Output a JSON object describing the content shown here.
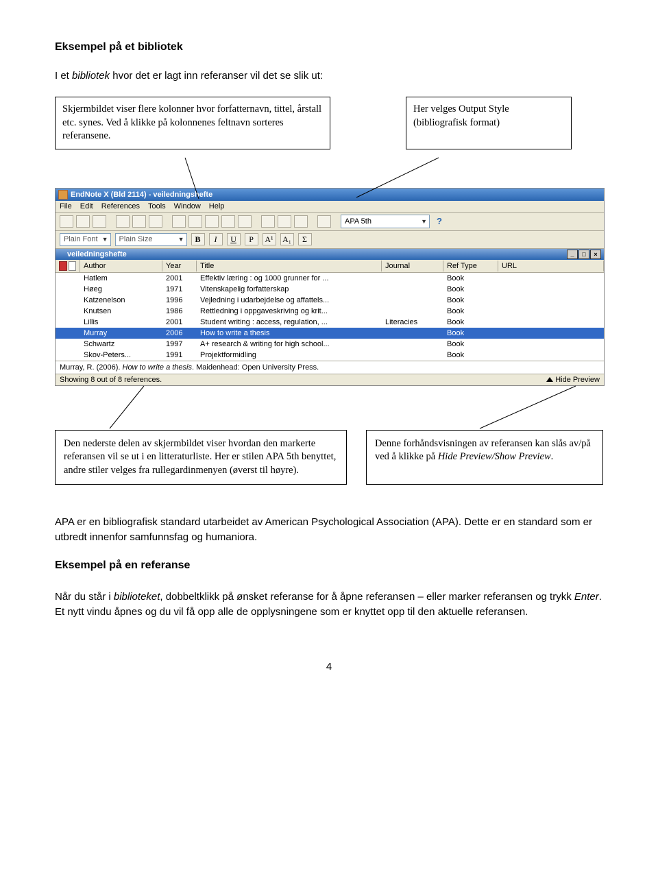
{
  "heading": "Eksempel på et bibliotek",
  "intro_1": "I et ",
  "intro_em": "bibliotek",
  "intro_2": " hvor det er lagt inn referanser vil det se slik ut:",
  "callout_left_top": "Skjermbildet viser flere kolonner hvor forfatternavn, tittel, årstall etc. synes. Ved å klikke på kolonnenes feltnavn sorteres referansene.",
  "callout_right_top": "Her velges Output Style (bibliografisk format)",
  "app": {
    "titlebar": "EndNote X (Bld 2114) - veiledningshefte",
    "menus": [
      "File",
      "Edit",
      "References",
      "Tools",
      "Window",
      "Help"
    ],
    "style_selected": "APA 5th",
    "plain_font": "Plain Font",
    "plain_size": "Plain Size",
    "fmt_buttons": [
      "B",
      "I",
      "U",
      "P",
      "A¹",
      "A₁",
      "Σ"
    ],
    "subwindow_title": "veiledningshefte",
    "columns": [
      "Author",
      "Year",
      "Title",
      "Journal",
      "Ref Type",
      "URL"
    ],
    "rows": [
      {
        "author": "Hatlem",
        "year": "2001",
        "title": "Effektiv læring : og 1000 grunner for ...",
        "journal": "",
        "ref": "Book",
        "url": ""
      },
      {
        "author": "Høeg",
        "year": "1971",
        "title": "Vitenskapelig forfatterskap",
        "journal": "",
        "ref": "Book",
        "url": ""
      },
      {
        "author": "Katzenelson",
        "year": "1996",
        "title": "Vejledning i udarbejdelse og affattels...",
        "journal": "",
        "ref": "Book",
        "url": ""
      },
      {
        "author": "Knutsen",
        "year": "1986",
        "title": "Rettledning i oppgaveskriving og krit...",
        "journal": "",
        "ref": "Book",
        "url": ""
      },
      {
        "author": "Lillis",
        "year": "2001",
        "title": "Student writing : access, regulation, ...",
        "journal": "Literacies",
        "ref": "Book",
        "url": ""
      },
      {
        "author": "Murray",
        "year": "2006",
        "title": "How to write a thesis",
        "journal": "",
        "ref": "Book",
        "url": "",
        "selected": true
      },
      {
        "author": "Schwartz",
        "year": "1997",
        "title": "A+ research & writing for high school...",
        "journal": "",
        "ref": "Book",
        "url": ""
      },
      {
        "author": "Skov-Peters...",
        "year": "1991",
        "title": "Projektformidling",
        "journal": "",
        "ref": "Book",
        "url": ""
      }
    ],
    "preview_author_year": "Murray, R. (2006). ",
    "preview_title_italic": "How to write a thesis",
    "preview_rest": ". Maidenhead: Open University Press.",
    "status_left": "Showing 8 out of 8 references.",
    "status_right": "Hide Preview"
  },
  "callout_left_bottom": "Den nederste delen av skjermbildet viser hvordan den markerte referansen vil se ut i en litteraturliste. Her er stilen APA 5th benyttet, andre stiler velges fra rullegardinmenyen (øverst til høyre).",
  "callout_right_bottom_1": "Denne forhåndsvisningen av referansen kan slås av/på ved å klikke på ",
  "callout_right_bottom_em": "Hide Preview/Show Preview",
  "callout_right_bottom_2": ".",
  "body_p1": "APA er en bibliografisk standard utarbeidet av American Psychological Association (APA). Dette er en standard som er utbredt innenfor samfunnsfag og humaniora.",
  "body_h2": "Eksempel på en referanse",
  "body_p2_1": "Når du står i ",
  "body_p2_em1": "biblioteket",
  "body_p2_2": ", dobbeltklikk på ønsket referanse for å åpne referansen – eller marker referansen og trykk ",
  "body_p2_em2": "Enter",
  "body_p2_3": ". Et nytt vindu åpnes og du vil få opp alle de opplysningene som er knyttet opp til den aktuelle referansen.",
  "page_number": "4"
}
